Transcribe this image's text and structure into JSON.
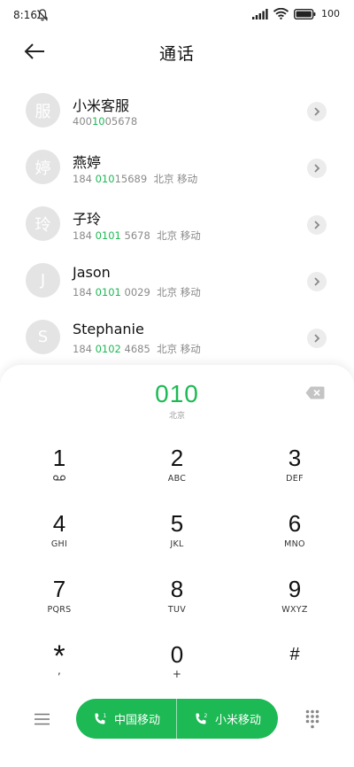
{
  "status_bar": {
    "time": "8:16",
    "battery_text": "100"
  },
  "header": {
    "title": "通话"
  },
  "contacts": [
    {
      "avatar": "服",
      "name": "小米客服",
      "number_pre": "400",
      "number_hl": "10",
      "number_post": "05678",
      "location": ""
    },
    {
      "avatar": "婷",
      "name": "燕婷",
      "number_pre": "184 ",
      "number_hl": "010",
      "number_post": "15689",
      "location": "北京 移动"
    },
    {
      "avatar": "玲",
      "name": "子玲",
      "number_pre": "184 ",
      "number_hl": "0101",
      "number_post": " 5678",
      "location": "北京 移动"
    },
    {
      "avatar": "J",
      "name": "Jason",
      "number_pre": "184 ",
      "number_hl": "0101",
      "number_post": " 0029",
      "location": "北京 移动"
    },
    {
      "avatar": "S",
      "name": "Stephanie",
      "number_pre": "184 ",
      "number_hl": "0102",
      "number_post": " 4685",
      "location": "北京 移动"
    }
  ],
  "dialer": {
    "digits": "010",
    "region": "北京",
    "keys": [
      {
        "digit": "1",
        "letters": ""
      },
      {
        "digit": "2",
        "letters": "ABC"
      },
      {
        "digit": "3",
        "letters": "DEF"
      },
      {
        "digit": "4",
        "letters": "GHI"
      },
      {
        "digit": "5",
        "letters": "JKL"
      },
      {
        "digit": "6",
        "letters": "MNO"
      },
      {
        "digit": "7",
        "letters": "PQRS"
      },
      {
        "digit": "8",
        "letters": "TUV"
      },
      {
        "digit": "9",
        "letters": "WXYZ"
      },
      {
        "digit": "*",
        "letters": ","
      },
      {
        "digit": "0",
        "letters": "+"
      },
      {
        "digit": "#",
        "letters": ""
      }
    ]
  },
  "call_buttons": {
    "sim1_label": "中国移动",
    "sim2_label": "小米移动"
  },
  "colors": {
    "accent": "#1db954",
    "avatar_bg": "#e4e4e4"
  }
}
